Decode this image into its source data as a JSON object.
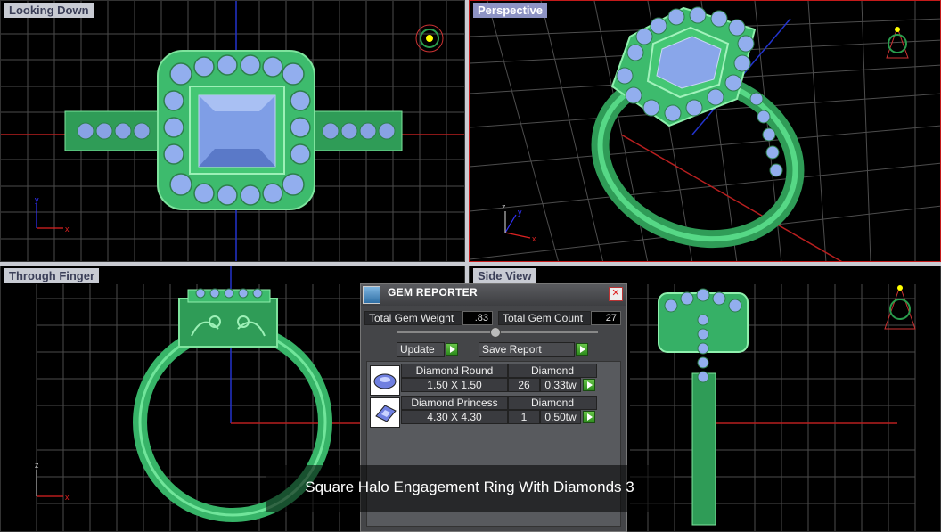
{
  "viewports": {
    "top_left": {
      "label": "Looking Down"
    },
    "top_right": {
      "label": "Perspective"
    },
    "bottom_left": {
      "label": "Through Finger"
    },
    "bottom_right": {
      "label": "Side View"
    }
  },
  "axes": {
    "x": "x",
    "y": "y",
    "z": "z"
  },
  "gem_reporter": {
    "title": "GEM REPORTER",
    "close_label": "✕",
    "total_gem_weight_label": "Total Gem Weight",
    "total_gem_weight_value": ".83",
    "total_gem_count_label": "Total Gem Count",
    "total_gem_count_value": "27",
    "update_label": "Update",
    "save_report_label": "Save Report",
    "gems": [
      {
        "name": "Diamond Round",
        "material": "Diamond",
        "size": "1.50 X 1.50",
        "count": "26",
        "weight": "0.33tw",
        "icon": "round-gem-icon"
      },
      {
        "name": "Diamond Princess",
        "material": "Diamond",
        "size": "4.30 X 4.30",
        "count": "1",
        "weight": "0.50tw",
        "icon": "princess-gem-icon"
      }
    ]
  },
  "caption": "Square Halo Engagement Ring With Diamonds 3",
  "colors": {
    "ring_metal": "#36b56a",
    "gem": "#8fa8ea",
    "grid": "#5a5a5a",
    "active_border": "#c41a1a"
  }
}
